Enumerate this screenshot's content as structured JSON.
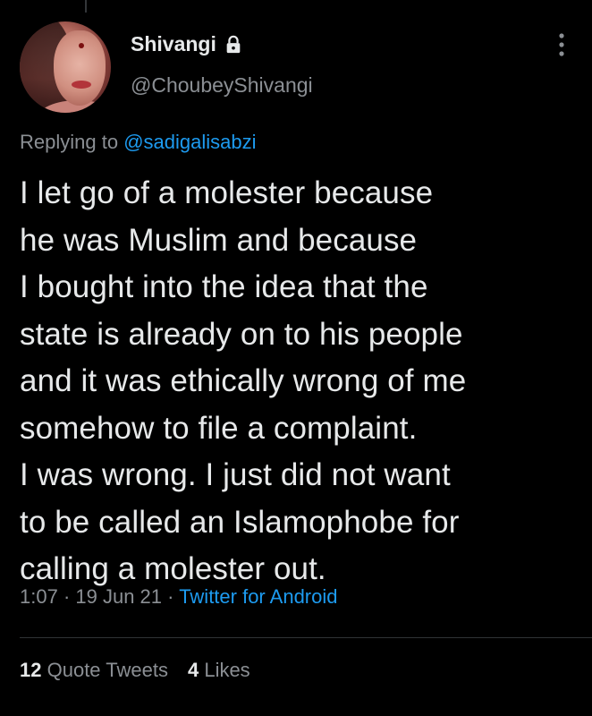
{
  "tweet": {
    "author": {
      "display_name": "Shivangi",
      "handle": "@ChoubeyShivangi",
      "protected_icon": "lock-icon"
    },
    "replying_to": {
      "prefix": "Replying to",
      "mention": "@sadigalisabzi"
    },
    "text_lines": [
      "I let go of a molester because",
      "he was Muslim and because",
      "I bought into the idea that the",
      "state is already on to his people",
      "and it was ethically wrong of me",
      "somehow to file a complaint.",
      "I was wrong. I just did not want",
      "to be called an Islamophobe for",
      "calling a molester out."
    ],
    "meta": {
      "time": "1:07",
      "separator": " · ",
      "date": "19 Jun 21",
      "source": "Twitter for Android"
    },
    "stats": {
      "quote_tweets_count": "12",
      "quote_tweets_label": "Quote Tweets",
      "likes_count": "4",
      "likes_label": "Likes"
    }
  },
  "colors": {
    "background": "#000000",
    "text_primary": "#e7e9ea",
    "text_secondary": "#8b8f94",
    "link": "#1d9bf0",
    "divider": "#2f3336"
  },
  "icons": {
    "more": "more-vertical-icon",
    "lock": "lock-icon"
  }
}
